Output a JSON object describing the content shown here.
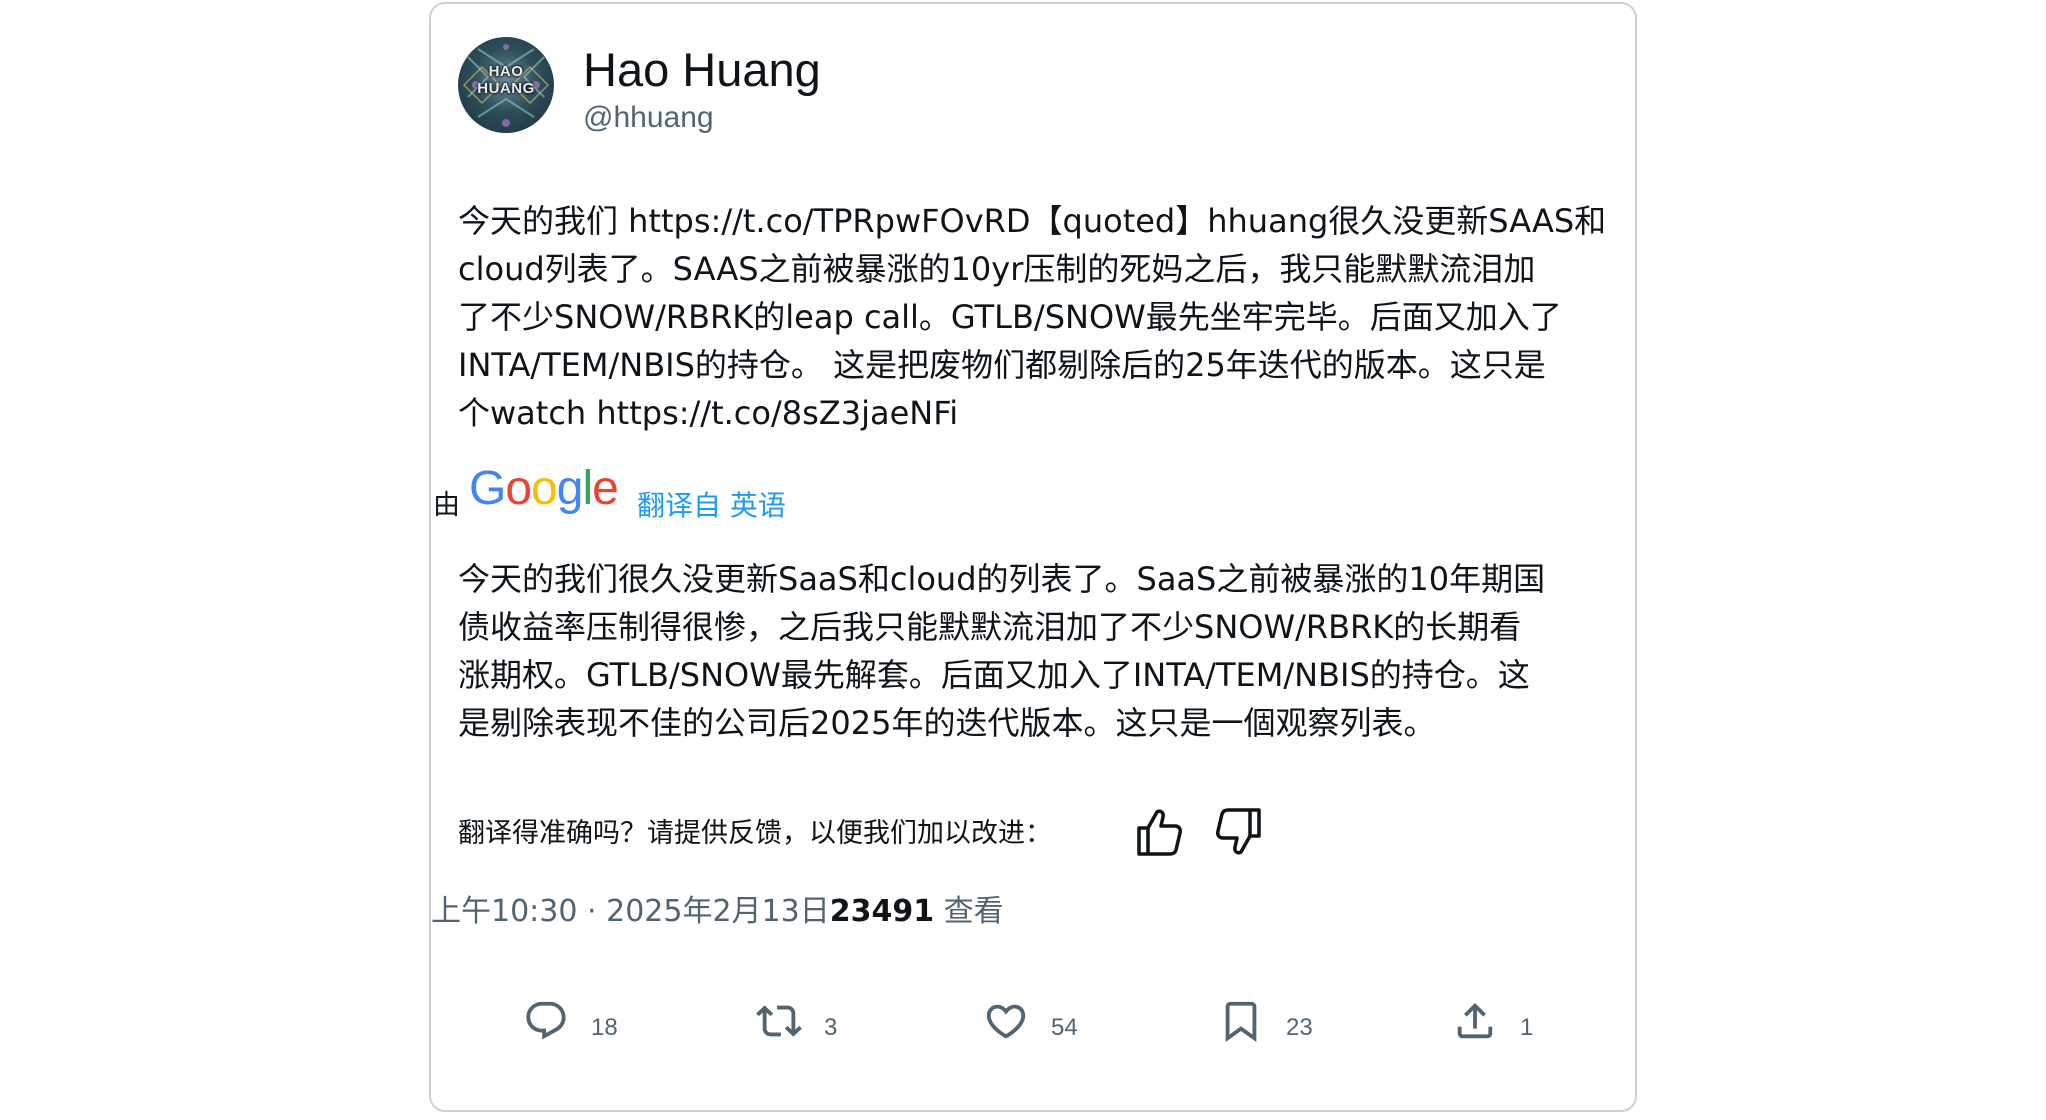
{
  "author": {
    "name": "Hao Huang",
    "handle": "@hhuang",
    "avatar_text_line1": "HAO",
    "avatar_text_line2": "HUANG"
  },
  "tweet": {
    "lines": [
      "今天的我们 https://t.co/TPRpwFOvRD【quoted】hhuang很久没更新SAAS和",
      "cloud列表了。SAAS之前被暴涨的10yr压制的死妈之后，我只能默默流泪加",
      "了不少SNOW/RBRK的leap call。GTLB/SNOW最先坐牢完毕。后面又加入了",
      "INTA/TEM/NBIS的持仓。 这是把废物们都剔除后的25年迭代的版本。这只是",
      "个watch https://t.co/8sZ3jaeNFi"
    ]
  },
  "translation": {
    "by_label": "由",
    "provider": "Google",
    "link_text": "翻译自 英语",
    "lines": [
      "今天的我们很久没更新SaaS和cloud的列表了。SaaS之前被暴涨的10年期国",
      "债收益率压制得很惨，之后我只能默默流泪加了不少SNOW/RBRK的长期看",
      "涨期权。GTLB/SNOW最先解套。后面又加入了INTA/TEM/NBIS的持仓。这",
      "是剔除表现不佳的公司后2025年的迭代版本。这只是一個观察列表。"
    ],
    "feedback_prompt": "翻译得准确吗？请提供反馈，以便我们加以改进："
  },
  "meta": {
    "time": "上午10:30",
    "separator": "·",
    "date": "2025年2月13日",
    "views_count": "23491",
    "views_label": " 查看"
  },
  "actions": {
    "replies": "18",
    "retweets": "3",
    "likes": "54",
    "bookmarks": "23",
    "shares": "1"
  },
  "colors": {
    "text": "#0f1419",
    "secondary": "#536471",
    "link": "#1d9bf0"
  },
  "icons": [
    "reply-icon",
    "retweet-icon",
    "like-icon",
    "bookmark-icon",
    "share-icon",
    "thumbs-up-icon",
    "thumbs-down-icon"
  ]
}
